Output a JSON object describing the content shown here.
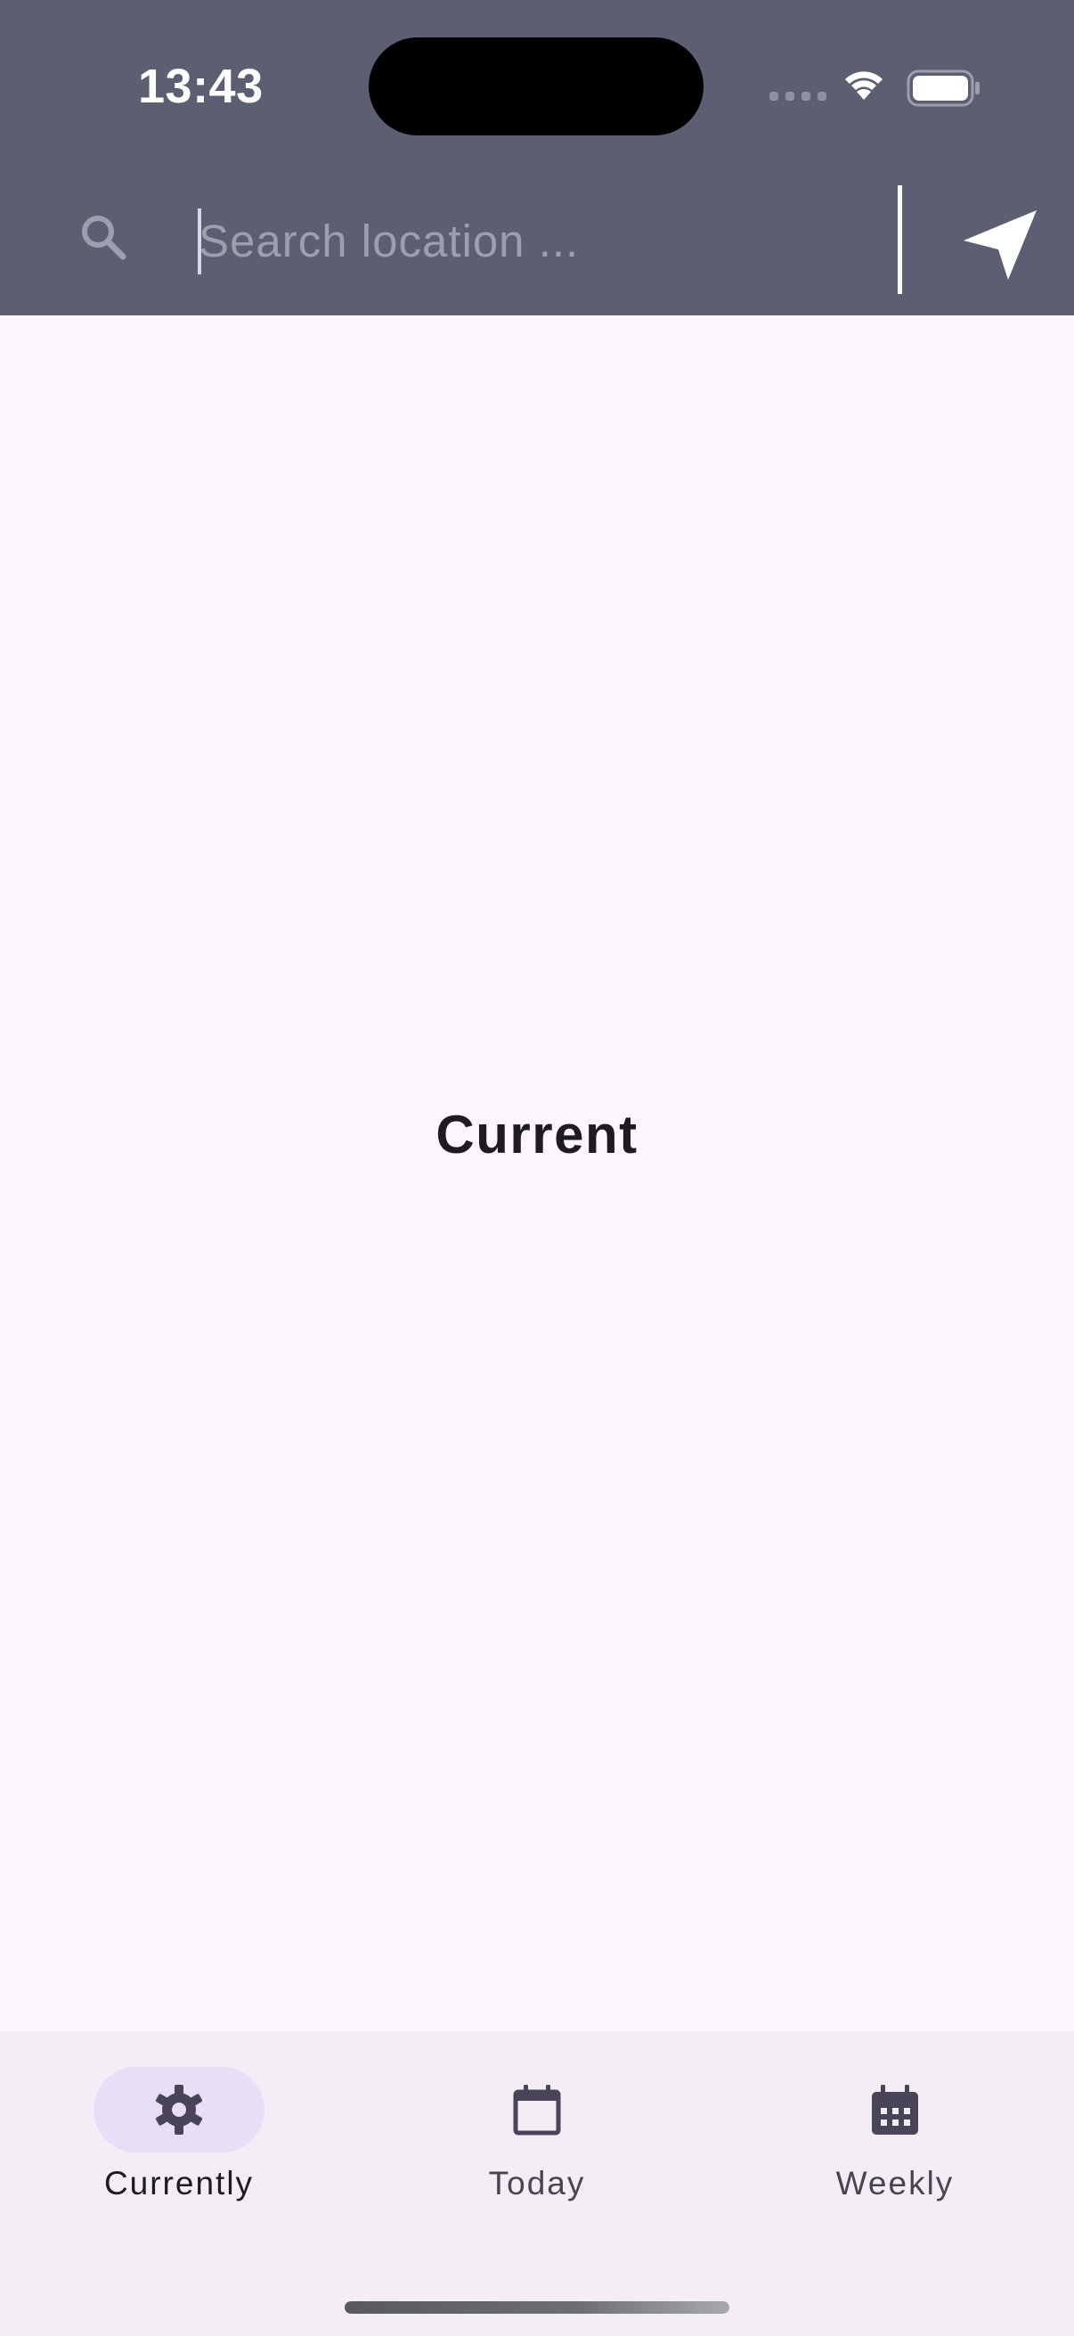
{
  "status_bar": {
    "time": "13:43"
  },
  "search": {
    "placeholder": "Search location ...",
    "value": ""
  },
  "main": {
    "title": "Current"
  },
  "bottom_nav": {
    "items": [
      {
        "label": "Currently",
        "icon": "gear-icon",
        "active": true
      },
      {
        "label": "Today",
        "icon": "calendar-icon",
        "active": false
      },
      {
        "label": "Weekly",
        "icon": "calendar-grid-icon",
        "active": false
      }
    ]
  },
  "colors": {
    "header_bg": "#5c5e72",
    "page_bg": "#fdf7fd",
    "nav_bg": "#f3edf6",
    "nav_active_pill": "#e8def8",
    "title_text": "#1f1b22"
  }
}
